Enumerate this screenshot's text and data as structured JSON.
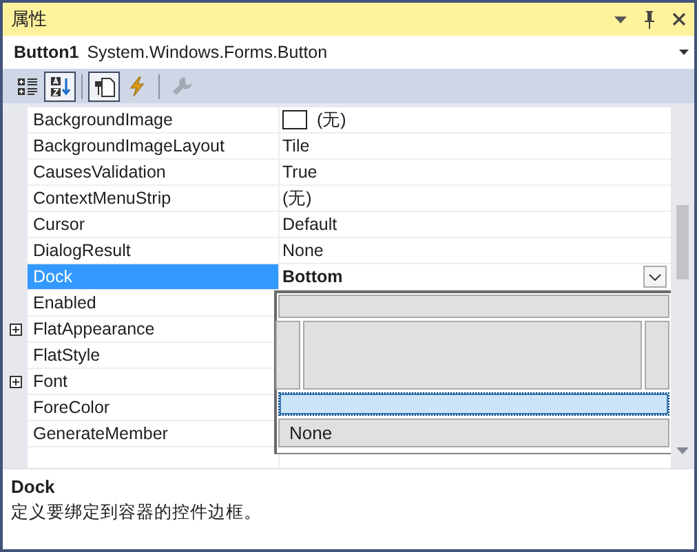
{
  "panel": {
    "title": "属性"
  },
  "object_selector": {
    "name": "Button1",
    "type": "System.Windows.Forms.Button"
  },
  "toolbar": [
    {
      "kind": "categorized",
      "selected": false
    },
    {
      "kind": "alphabetical",
      "selected": true
    },
    {
      "kind": "properties",
      "selected": true
    },
    {
      "kind": "events",
      "selected": false
    },
    {
      "kind": "property_pages",
      "selected": false,
      "disabled": true
    }
  ],
  "properties": [
    {
      "name": "BackgroundImage",
      "value": "(无)",
      "swatch": true,
      "selected": false
    },
    {
      "name": "BackgroundImageLayout",
      "value": "Tile",
      "selected": false
    },
    {
      "name": "CausesValidation",
      "value": "True",
      "selected": false
    },
    {
      "name": "ContextMenuStrip",
      "value": "(无)",
      "selected": false
    },
    {
      "name": "Cursor",
      "value": "Default",
      "selected": false
    },
    {
      "name": "DialogResult",
      "value": "None",
      "selected": false
    },
    {
      "name": "Dock",
      "value": "Bottom",
      "selected": true,
      "modified": true
    },
    {
      "name": "Enabled",
      "selected": false
    },
    {
      "name": "FlatAppearance",
      "expandable": true,
      "selected": false
    },
    {
      "name": "FlatStyle",
      "selected": false
    },
    {
      "name": "Font",
      "expandable": true,
      "selected": false
    },
    {
      "name": "ForeColor",
      "selected": false
    },
    {
      "name": "GenerateMember",
      "selected": false
    }
  ],
  "dock_editor": [
    {
      "kind": "top",
      "selected": false
    },
    {
      "kind": "left",
      "selected": false
    },
    {
      "kind": "fill",
      "selected": false
    },
    {
      "kind": "right",
      "selected": false
    },
    {
      "kind": "bottom",
      "selected": true
    },
    {
      "kind": "none",
      "label": "None",
      "selected": false
    }
  ],
  "description": {
    "title": "Dock",
    "text": "定义要绑定到容器的控件边框。"
  }
}
